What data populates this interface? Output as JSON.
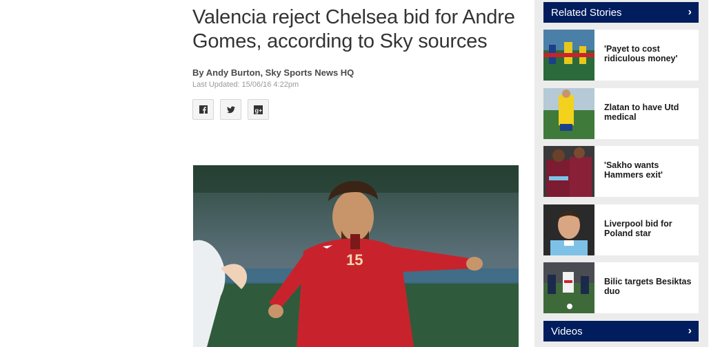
{
  "article": {
    "headline": "Valencia reject Chelsea bid for Andre Gomes, according to Sky sources",
    "byline": "By Andy Burton, Sky Sports News HQ",
    "last_updated": "Last Updated: 15/06/16 4:22pm",
    "share": [
      "facebook-icon",
      "twitter-icon",
      "google-plus-icon"
    ],
    "hero_player_number": "15"
  },
  "sidebar": {
    "related_heading": "Related Stories",
    "stories": [
      {
        "title": "'Payet to cost ridiculous money'"
      },
      {
        "title": "Zlatan to have Utd medical"
      },
      {
        "title": "'Sakho wants Hammers exit'"
      },
      {
        "title": "Liverpool bid for Poland star"
      },
      {
        "title": "Bilic targets Besiktas duo"
      }
    ],
    "videos_heading": "Videos"
  },
  "colors": {
    "heading_bg": "#011d5e",
    "sidebar_bg": "#ececec",
    "kit_red": "#c8232c"
  }
}
